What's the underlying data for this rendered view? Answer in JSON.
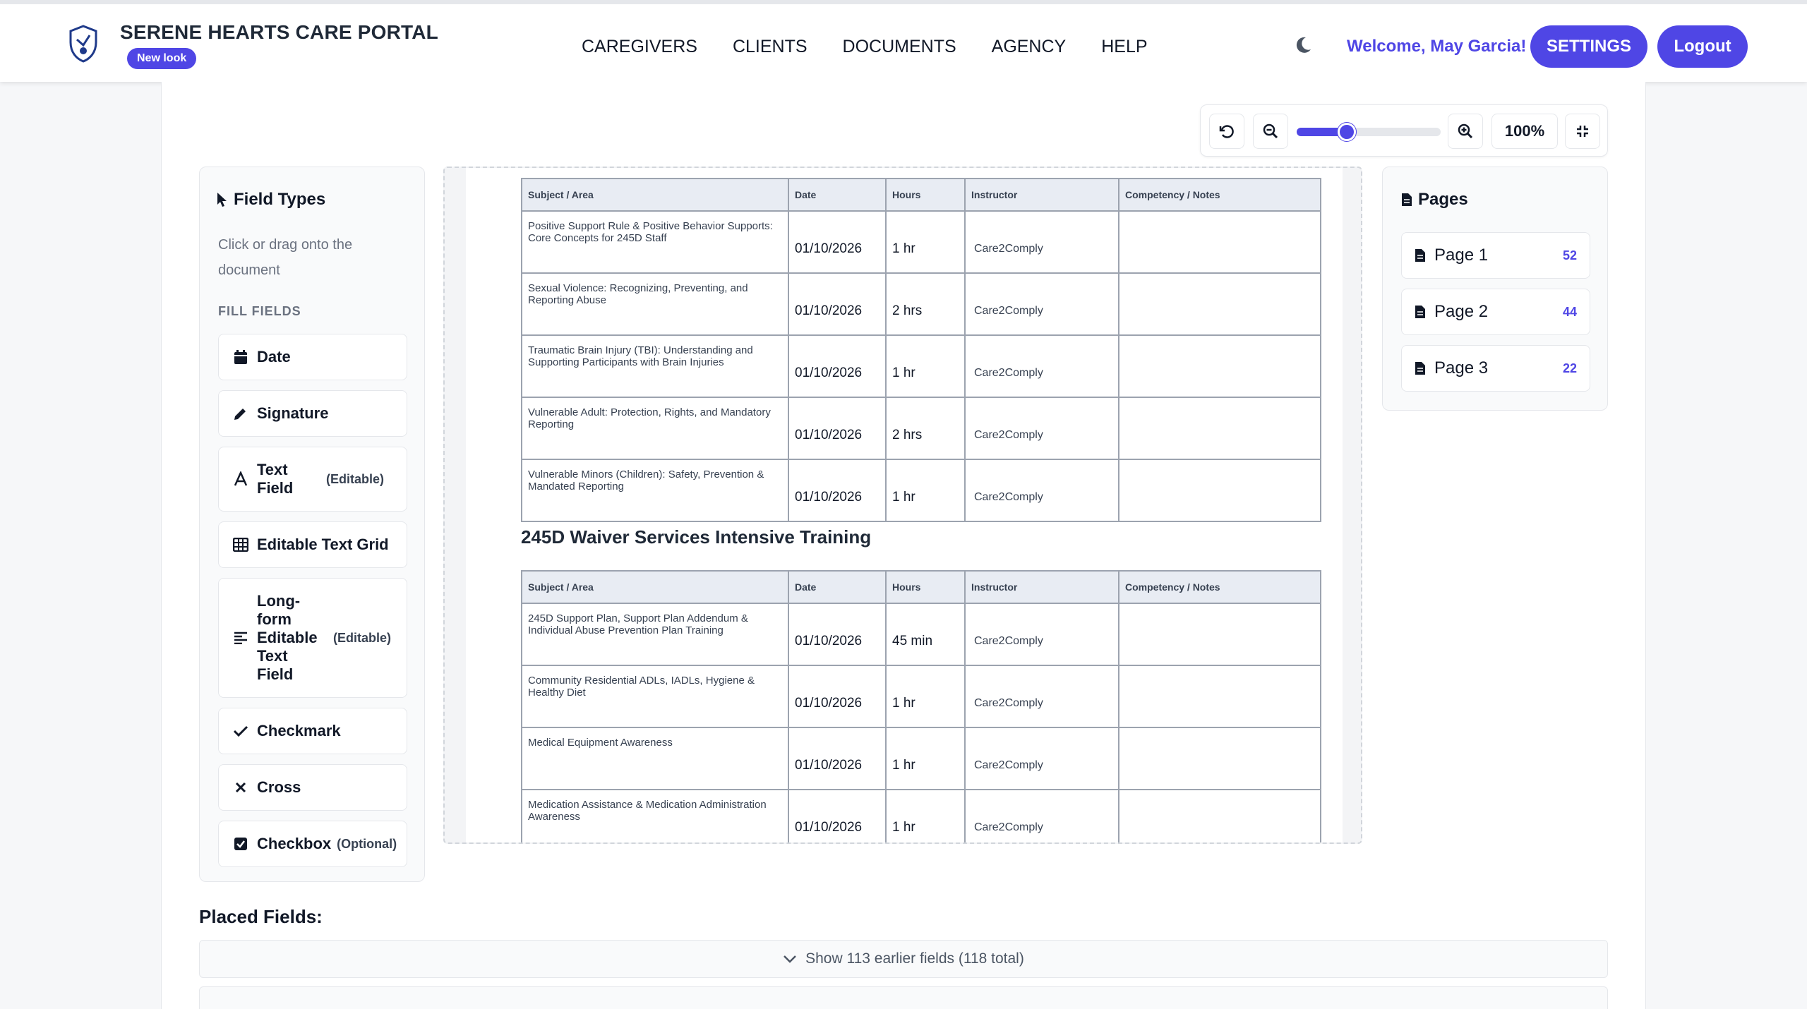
{
  "header": {
    "brand": "SERENE HEARTS CARE PORTAL",
    "badge": "New look",
    "nav": [
      "CAREGIVERS",
      "CLIENTS",
      "DOCUMENTS",
      "AGENCY",
      "HELP"
    ],
    "welcome": "Welcome, May Garcia!",
    "settings_label": "SETTINGS",
    "logout_label": "Logout",
    "accent_color": "#4f46e5"
  },
  "zoom": {
    "percent_label": "100%",
    "slider_fraction": 0.35
  },
  "field_types": {
    "title": "Field Types",
    "hint": "Click or drag onto the document",
    "section": "FILL FIELDS",
    "items": [
      {
        "label": "Date",
        "tag": "",
        "icon": "calendar-icon"
      },
      {
        "label": "Signature",
        "tag": "",
        "icon": "pencil-icon"
      },
      {
        "label": "Text Field",
        "tag": "(Editable)",
        "icon": "text-icon"
      },
      {
        "label": "Editable Text Grid",
        "tag": "",
        "icon": "grid-icon"
      },
      {
        "label": "Long-form Editable Text Field",
        "tag": "(Editable)",
        "icon": "align-left-icon"
      },
      {
        "label": "Checkmark",
        "tag": "",
        "icon": "check-icon"
      },
      {
        "label": "Cross",
        "tag": "",
        "icon": "cross-icon"
      },
      {
        "label": "Checkbox",
        "tag": "(Optional)",
        "icon": "checkbox-icon"
      }
    ]
  },
  "document": {
    "columns": [
      "Subject / Area",
      "Date",
      "Hours",
      "Instructor",
      "Competency / Notes"
    ],
    "table1": [
      {
        "subject": "Positive Support Rule & Positive Behavior Supports: Core Concepts for 245D Staff",
        "date": "01/10/2026",
        "hours": "1 hr",
        "instructor": "Care2Comply",
        "notes": ""
      },
      {
        "subject": "Sexual Violence: Recognizing, Preventing, and Reporting Abuse",
        "date": "01/10/2026",
        "hours": "2 hrs",
        "instructor": "Care2Comply",
        "notes": ""
      },
      {
        "subject": "Traumatic Brain Injury (TBI): Understanding and Supporting Participants with Brain Injuries",
        "date": "01/10/2026",
        "hours": "1 hr",
        "instructor": "Care2Comply",
        "notes": ""
      },
      {
        "subject": "Vulnerable Adult: Protection, Rights, and Mandatory Reporting",
        "date": "01/10/2026",
        "hours": "2 hrs",
        "instructor": "Care2Comply",
        "notes": ""
      },
      {
        "subject": "Vulnerable Minors (Children): Safety, Prevention & Mandated Reporting",
        "date": "01/10/2026",
        "hours": "1 hr",
        "instructor": "Care2Comply",
        "notes": ""
      }
    ],
    "section_title": "245D Waiver Services Intensive Training",
    "table2": [
      {
        "subject": "245D Support Plan, Support Plan Addendum & Individual Abuse Prevention Plan Training",
        "date": "01/10/2026",
        "hours": "45 min",
        "instructor": "Care2Comply",
        "notes": ""
      },
      {
        "subject": "Community Residential ADLs, IADLs, Hygiene & Healthy Diet",
        "date": "01/10/2026",
        "hours": "1 hr",
        "instructor": "Care2Comply",
        "notes": ""
      },
      {
        "subject": "Medical Equipment Awareness",
        "date": "01/10/2026",
        "hours": "1 hr",
        "instructor": "Care2Comply",
        "notes": ""
      },
      {
        "subject": "Medication Assistance & Medication Administration Awareness",
        "date": "01/10/2026",
        "hours": "1 hr",
        "instructor": "Care2Comply",
        "notes": ""
      }
    ]
  },
  "pages": {
    "title": "Pages",
    "items": [
      {
        "label": "Page 1",
        "count": "52"
      },
      {
        "label": "Page 2",
        "count": "44"
      },
      {
        "label": "Page 3",
        "count": "22"
      }
    ]
  },
  "placed": {
    "title": "Placed Fields:",
    "show_earlier": "Show 113 earlier fields (118 total)"
  }
}
